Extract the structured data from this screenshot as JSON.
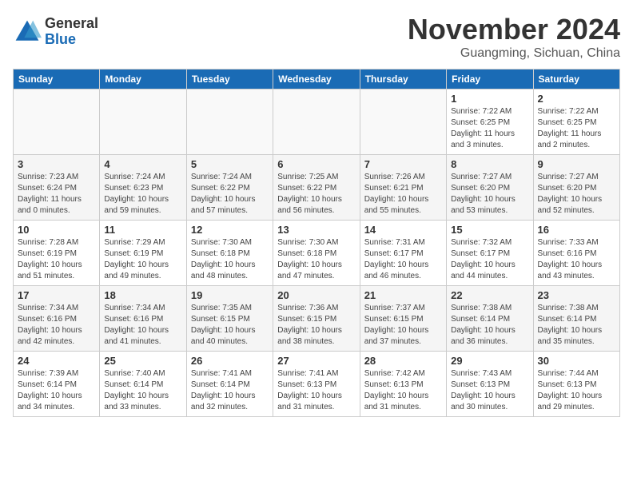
{
  "header": {
    "logo_general": "General",
    "logo_blue": "Blue",
    "month_title": "November 2024",
    "location": "Guangming, Sichuan, China"
  },
  "days_of_week": [
    "Sunday",
    "Monday",
    "Tuesday",
    "Wednesday",
    "Thursday",
    "Friday",
    "Saturday"
  ],
  "weeks": [
    {
      "days": [
        {
          "date": "",
          "info": ""
        },
        {
          "date": "",
          "info": ""
        },
        {
          "date": "",
          "info": ""
        },
        {
          "date": "",
          "info": ""
        },
        {
          "date": "",
          "info": ""
        },
        {
          "date": "1",
          "info": "Sunrise: 7:22 AM\nSunset: 6:25 PM\nDaylight: 11 hours\nand 3 minutes."
        },
        {
          "date": "2",
          "info": "Sunrise: 7:22 AM\nSunset: 6:25 PM\nDaylight: 11 hours\nand 2 minutes."
        }
      ]
    },
    {
      "days": [
        {
          "date": "3",
          "info": "Sunrise: 7:23 AM\nSunset: 6:24 PM\nDaylight: 11 hours\nand 0 minutes."
        },
        {
          "date": "4",
          "info": "Sunrise: 7:24 AM\nSunset: 6:23 PM\nDaylight: 10 hours\nand 59 minutes."
        },
        {
          "date": "5",
          "info": "Sunrise: 7:24 AM\nSunset: 6:22 PM\nDaylight: 10 hours\nand 57 minutes."
        },
        {
          "date": "6",
          "info": "Sunrise: 7:25 AM\nSunset: 6:22 PM\nDaylight: 10 hours\nand 56 minutes."
        },
        {
          "date": "7",
          "info": "Sunrise: 7:26 AM\nSunset: 6:21 PM\nDaylight: 10 hours\nand 55 minutes."
        },
        {
          "date": "8",
          "info": "Sunrise: 7:27 AM\nSunset: 6:20 PM\nDaylight: 10 hours\nand 53 minutes."
        },
        {
          "date": "9",
          "info": "Sunrise: 7:27 AM\nSunset: 6:20 PM\nDaylight: 10 hours\nand 52 minutes."
        }
      ]
    },
    {
      "days": [
        {
          "date": "10",
          "info": "Sunrise: 7:28 AM\nSunset: 6:19 PM\nDaylight: 10 hours\nand 51 minutes."
        },
        {
          "date": "11",
          "info": "Sunrise: 7:29 AM\nSunset: 6:19 PM\nDaylight: 10 hours\nand 49 minutes."
        },
        {
          "date": "12",
          "info": "Sunrise: 7:30 AM\nSunset: 6:18 PM\nDaylight: 10 hours\nand 48 minutes."
        },
        {
          "date": "13",
          "info": "Sunrise: 7:30 AM\nSunset: 6:18 PM\nDaylight: 10 hours\nand 47 minutes."
        },
        {
          "date": "14",
          "info": "Sunrise: 7:31 AM\nSunset: 6:17 PM\nDaylight: 10 hours\nand 46 minutes."
        },
        {
          "date": "15",
          "info": "Sunrise: 7:32 AM\nSunset: 6:17 PM\nDaylight: 10 hours\nand 44 minutes."
        },
        {
          "date": "16",
          "info": "Sunrise: 7:33 AM\nSunset: 6:16 PM\nDaylight: 10 hours\nand 43 minutes."
        }
      ]
    },
    {
      "days": [
        {
          "date": "17",
          "info": "Sunrise: 7:34 AM\nSunset: 6:16 PM\nDaylight: 10 hours\nand 42 minutes."
        },
        {
          "date": "18",
          "info": "Sunrise: 7:34 AM\nSunset: 6:16 PM\nDaylight: 10 hours\nand 41 minutes."
        },
        {
          "date": "19",
          "info": "Sunrise: 7:35 AM\nSunset: 6:15 PM\nDaylight: 10 hours\nand 40 minutes."
        },
        {
          "date": "20",
          "info": "Sunrise: 7:36 AM\nSunset: 6:15 PM\nDaylight: 10 hours\nand 38 minutes."
        },
        {
          "date": "21",
          "info": "Sunrise: 7:37 AM\nSunset: 6:15 PM\nDaylight: 10 hours\nand 37 minutes."
        },
        {
          "date": "22",
          "info": "Sunrise: 7:38 AM\nSunset: 6:14 PM\nDaylight: 10 hours\nand 36 minutes."
        },
        {
          "date": "23",
          "info": "Sunrise: 7:38 AM\nSunset: 6:14 PM\nDaylight: 10 hours\nand 35 minutes."
        }
      ]
    },
    {
      "days": [
        {
          "date": "24",
          "info": "Sunrise: 7:39 AM\nSunset: 6:14 PM\nDaylight: 10 hours\nand 34 minutes."
        },
        {
          "date": "25",
          "info": "Sunrise: 7:40 AM\nSunset: 6:14 PM\nDaylight: 10 hours\nand 33 minutes."
        },
        {
          "date": "26",
          "info": "Sunrise: 7:41 AM\nSunset: 6:14 PM\nDaylight: 10 hours\nand 32 minutes."
        },
        {
          "date": "27",
          "info": "Sunrise: 7:41 AM\nSunset: 6:13 PM\nDaylight: 10 hours\nand 31 minutes."
        },
        {
          "date": "28",
          "info": "Sunrise: 7:42 AM\nSunset: 6:13 PM\nDaylight: 10 hours\nand 31 minutes."
        },
        {
          "date": "29",
          "info": "Sunrise: 7:43 AM\nSunset: 6:13 PM\nDaylight: 10 hours\nand 30 minutes."
        },
        {
          "date": "30",
          "info": "Sunrise: 7:44 AM\nSunset: 6:13 PM\nDaylight: 10 hours\nand 29 minutes."
        }
      ]
    }
  ]
}
